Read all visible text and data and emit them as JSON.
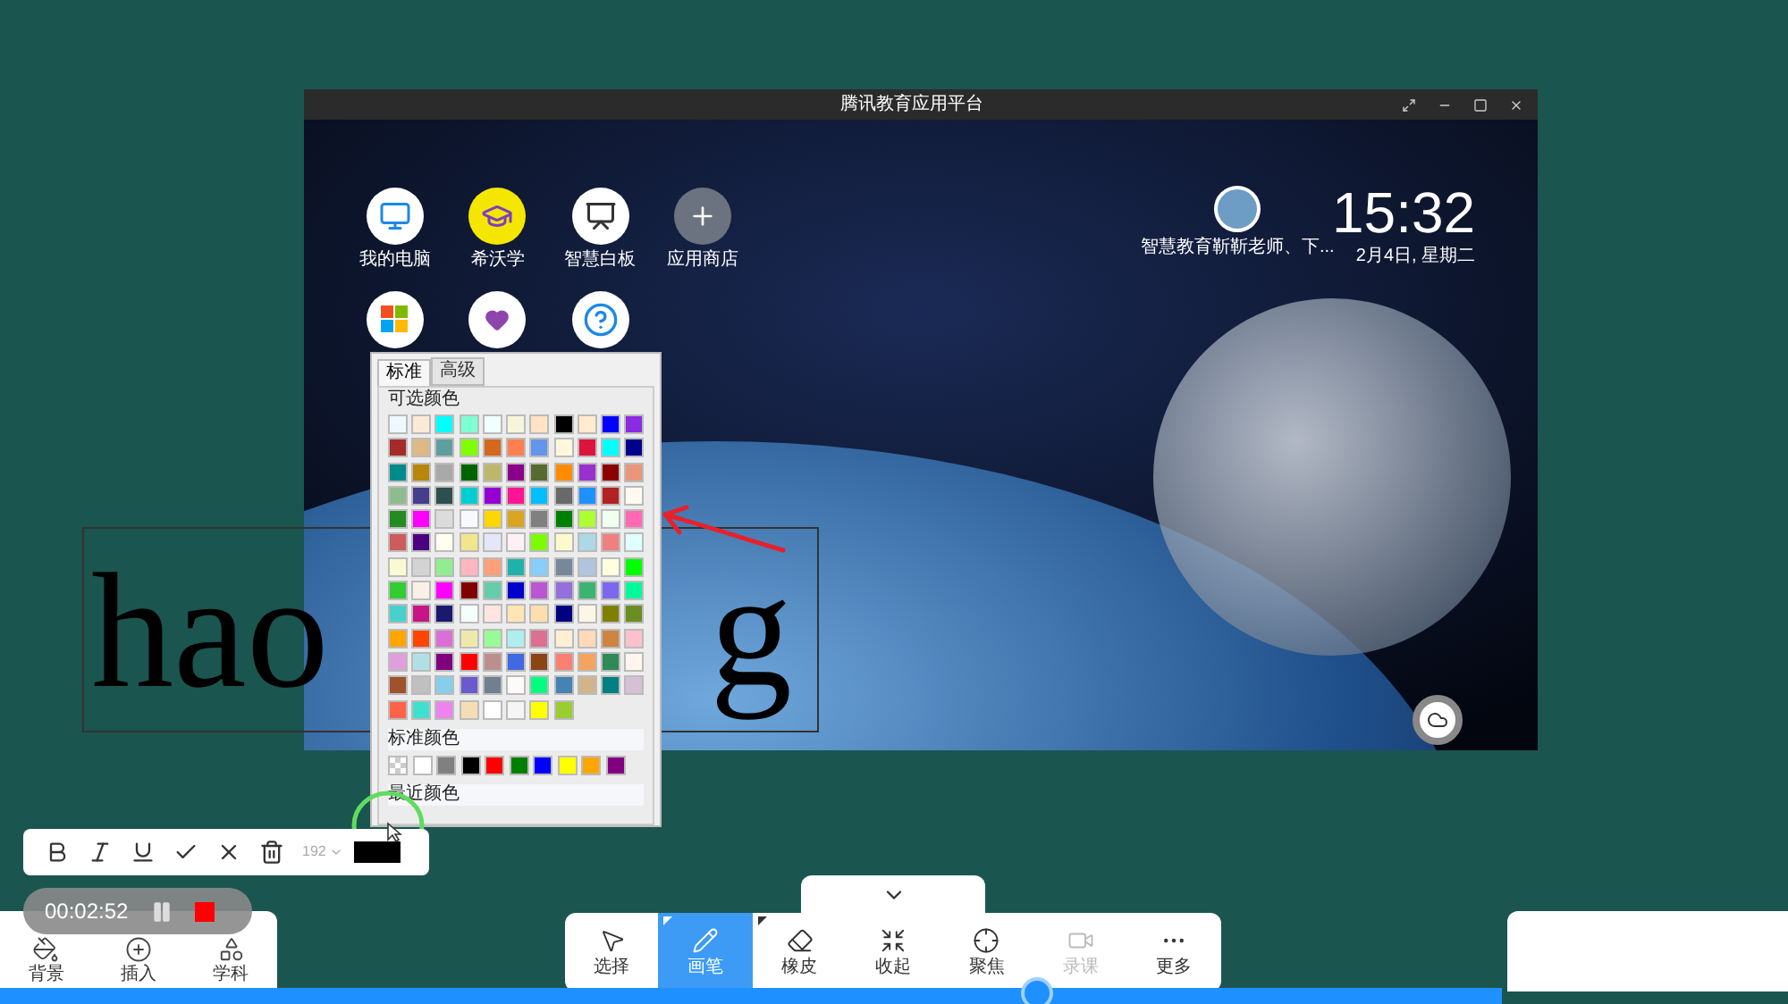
{
  "window": {
    "title": "腾讯教育应用平台"
  },
  "desktop": {
    "apps": [
      {
        "label": "我的电脑"
      },
      {
        "label": "希沃学"
      },
      {
        "label": "智慧白板"
      },
      {
        "label": "应用商店"
      }
    ]
  },
  "profile": {
    "caption": "智慧教育靳靳老师、下..."
  },
  "clock": {
    "time": "15:32",
    "date": "2月4日, 星期二"
  },
  "canvas_text": {
    "start": "hao",
    "end": "g"
  },
  "color_picker": {
    "tabs": [
      {
        "label": "标准",
        "selected": true
      },
      {
        "label": "高级",
        "selected": false
      }
    ],
    "palette_title": "可选颜色",
    "palette": [
      {
        "color": "#f0f8ff"
      },
      {
        "color": "#faebd7"
      },
      {
        "color": "#00ffff"
      },
      {
        "color": "#7fffd4"
      },
      {
        "color": "#f0ffff"
      },
      {
        "color": "#f5f5dc"
      },
      {
        "color": "#ffe4c4"
      },
      {
        "color": "#000000"
      },
      {
        "color": "#ffebcd"
      },
      {
        "color": "#0000ff"
      },
      {
        "color": "#8a2be2"
      },
      {
        "color": "#a52a2a"
      },
      {
        "color": "#deb887"
      },
      {
        "color": "#5f9ea0"
      },
      {
        "color": "#7fff00"
      },
      {
        "color": "#d2691e"
      },
      {
        "color": "#ff7f50"
      },
      {
        "color": "#6495ed"
      },
      {
        "color": "#fff8dc"
      },
      {
        "color": "#dc143c"
      },
      {
        "color": "#00ffff"
      },
      {
        "color": "#00008b"
      },
      {
        "color": "#008b8b"
      },
      {
        "color": "#b8860b"
      },
      {
        "color": "#a9a9a9"
      },
      {
        "color": "#006400"
      },
      {
        "color": "#bdb76b"
      },
      {
        "color": "#8b008b"
      },
      {
        "color": "#556b2f"
      },
      {
        "color": "#ff8c00"
      },
      {
        "color": "#9932cc"
      },
      {
        "color": "#8b0000"
      },
      {
        "color": "#e9967a"
      },
      {
        "color": "#8fbc8f"
      },
      {
        "color": "#483d8b"
      },
      {
        "color": "#2f4f4f"
      },
      {
        "color": "#00ced1"
      },
      {
        "color": "#9400d3"
      },
      {
        "color": "#ff1493"
      },
      {
        "color": "#00bfff"
      },
      {
        "color": "#696969"
      },
      {
        "color": "#1e90ff"
      },
      {
        "color": "#b22222"
      },
      {
        "color": "#fffaf0"
      },
      {
        "color": "#228b22"
      },
      {
        "color": "#ff00ff"
      },
      {
        "color": "#dcdcdc"
      },
      {
        "color": "#f8f8ff"
      },
      {
        "color": "#ffd700"
      },
      {
        "color": "#daa520"
      },
      {
        "color": "#808080"
      },
      {
        "color": "#008000"
      },
      {
        "color": "#adff2f"
      },
      {
        "color": "#f0fff0"
      },
      {
        "color": "#ff69b4"
      },
      {
        "color": "#cd5c5c"
      },
      {
        "color": "#4b0082"
      },
      {
        "color": "#fffff0"
      },
      {
        "color": "#f0e68c"
      },
      {
        "color": "#e6e6fa"
      },
      {
        "color": "#fff0f5"
      },
      {
        "color": "#7cfc00"
      },
      {
        "color": "#fffacd"
      },
      {
        "color": "#add8e6"
      },
      {
        "color": "#f08080"
      },
      {
        "color": "#e0ffff"
      },
      {
        "color": "#fafad2"
      },
      {
        "color": "#d3d3d3"
      },
      {
        "color": "#90ee90"
      },
      {
        "color": "#ffb6c1"
      },
      {
        "color": "#ffa07a"
      },
      {
        "color": "#20b2aa"
      },
      {
        "color": "#87cefa"
      },
      {
        "color": "#778899"
      },
      {
        "color": "#b0c4de"
      },
      {
        "color": "#ffffe0"
      },
      {
        "color": "#00ff00"
      },
      {
        "color": "#32cd32"
      },
      {
        "color": "#faf0e6"
      },
      {
        "color": "#ff00ff"
      },
      {
        "color": "#800000"
      },
      {
        "color": "#66cdaa"
      },
      {
        "color": "#0000cd"
      },
      {
        "color": "#ba55d3"
      },
      {
        "color": "#9370db"
      },
      {
        "color": "#3cb371"
      },
      {
        "color": "#7b68ee"
      },
      {
        "color": "#00fa9a"
      },
      {
        "color": "#48d1cc"
      },
      {
        "color": "#c71585"
      },
      {
        "color": "#191970"
      },
      {
        "color": "#f5fffa"
      },
      {
        "color": "#ffe4e1"
      },
      {
        "color": "#ffe4b5"
      },
      {
        "color": "#ffdead"
      },
      {
        "color": "#000080"
      },
      {
        "color": "#fdf5e6"
      },
      {
        "color": "#808000"
      },
      {
        "color": "#6b8e23"
      },
      {
        "color": "#ffa500"
      },
      {
        "color": "#ff4500"
      },
      {
        "color": "#da70d6"
      },
      {
        "color": "#eee8aa"
      },
      {
        "color": "#98fb98"
      },
      {
        "color": "#afeeee"
      },
      {
        "color": "#db7093"
      },
      {
        "color": "#ffefd5"
      },
      {
        "color": "#ffdab9"
      },
      {
        "color": "#cd853f"
      },
      {
        "color": "#ffc0cb"
      },
      {
        "color": "#dda0dd"
      },
      {
        "color": "#b0e0e6"
      },
      {
        "color": "#800080"
      },
      {
        "color": "#ff0000"
      },
      {
        "color": "#bc8f8f"
      },
      {
        "color": "#4169e1"
      },
      {
        "color": "#8b4513"
      },
      {
        "color": "#fa8072"
      },
      {
        "color": "#f4a460"
      },
      {
        "color": "#2e8b57"
      },
      {
        "color": "#fff5ee"
      },
      {
        "color": "#a0522d"
      },
      {
        "color": "#c0c0c0"
      },
      {
        "color": "#87ceeb"
      },
      {
        "color": "#6a5acd"
      },
      {
        "color": "#708090"
      },
      {
        "color": "#fffafa"
      },
      {
        "color": "#00ff7f"
      },
      {
        "color": "#4682b4"
      },
      {
        "color": "#d2b48c"
      },
      {
        "color": "#008080"
      },
      {
        "color": "#d8bfd8"
      },
      {
        "color": "#ff6347"
      },
      {
        "color": "#40e0d0"
      },
      {
        "color": "#ee82ee"
      },
      {
        "color": "#f5deb3"
      },
      {
        "color": "#ffffff"
      },
      {
        "color": "#f5f5f5"
      },
      {
        "color": "#ffff00"
      },
      {
        "color": "#9acd32"
      }
    ],
    "standard_title": "标准颜色",
    "standard": [
      {
        "kind": "transparent"
      },
      {
        "kind": "solid",
        "color": "#ffffff"
      },
      {
        "kind": "solid",
        "color": "#808080"
      },
      {
        "kind": "solid",
        "color": "#000000"
      },
      {
        "kind": "solid",
        "color": "#ff0000"
      },
      {
        "kind": "solid",
        "color": "#008000"
      },
      {
        "kind": "solid",
        "color": "#0000ff"
      },
      {
        "kind": "solid",
        "color": "#ffff00"
      },
      {
        "kind": "solid",
        "color": "#ffa500"
      },
      {
        "kind": "solid",
        "color": "#800080"
      }
    ],
    "recent_title": "最近颜色"
  },
  "format_toolbar": {
    "font_size": "192"
  },
  "recorder": {
    "time": "00:02:52"
  },
  "left_dock": [
    {
      "label": "背景"
    },
    {
      "label": "插入"
    },
    {
      "label": "学科"
    }
  ],
  "main_toolbar": [
    {
      "label": "选择",
      "selected": false,
      "disabled": false,
      "has_menu": false
    },
    {
      "label": "画笔",
      "selected": true,
      "disabled": false,
      "has_menu": true
    },
    {
      "label": "橡皮",
      "selected": false,
      "disabled": false,
      "has_menu": true
    },
    {
      "label": "收起",
      "selected": false,
      "disabled": false,
      "has_menu": false
    },
    {
      "label": "聚焦",
      "selected": false,
      "disabled": false,
      "has_menu": false
    },
    {
      "label": "录课",
      "selected": false,
      "disabled": true,
      "has_menu": false
    },
    {
      "label": "更多",
      "selected": false,
      "disabled": false,
      "has_menu": false
    }
  ],
  "playback": {
    "level": 0.69
  }
}
